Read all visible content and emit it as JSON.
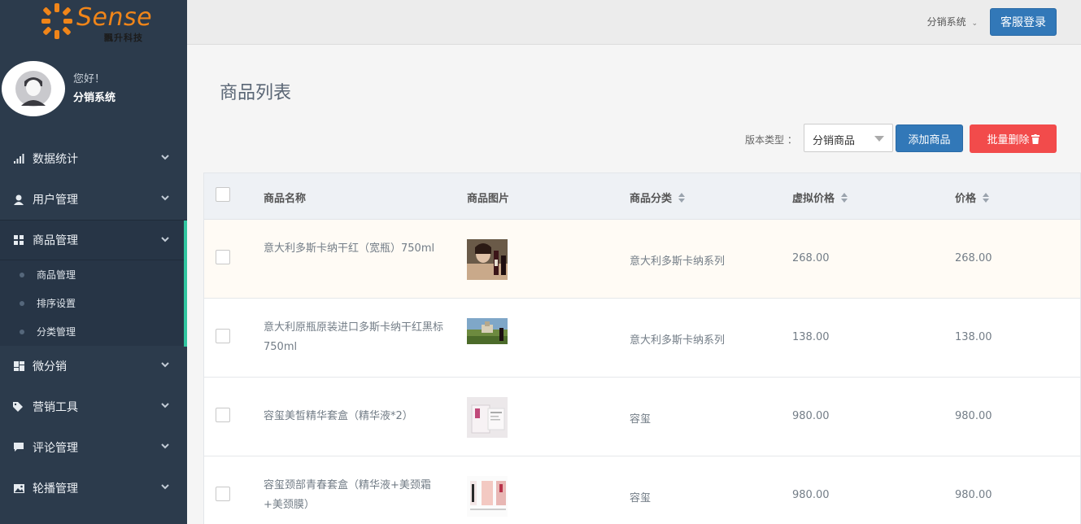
{
  "sidebar": {
    "logo_text": "Sense",
    "logo_sub": "飄升科技",
    "greeting": "您好！",
    "user_name": "分销系统",
    "menu": [
      {
        "label": "数据统计",
        "icon": "bar-chart-icon"
      },
      {
        "label": "用户管理",
        "icon": "user-icon"
      },
      {
        "label": "商品管理",
        "icon": "grid-icon",
        "active": true
      },
      {
        "label": "微分销",
        "icon": "tiles-icon"
      },
      {
        "label": "营销工具",
        "icon": "tag-icon"
      },
      {
        "label": "评论管理",
        "icon": "comment-icon"
      },
      {
        "label": "轮播管理",
        "icon": "picture-icon"
      }
    ],
    "submenu": [
      "商品管理",
      "排序设置",
      "分类管理"
    ]
  },
  "topbar": {
    "system_switch": "分销系统",
    "login_button": "客服登录"
  },
  "page": {
    "title": "商品列表",
    "filter_label": "版本类型 ：",
    "filter_value": "分销商品",
    "add_button": "添加商品",
    "batch_delete_button": "批量删除"
  },
  "table": {
    "columns": [
      "商品名称",
      "商品图片",
      "商品分类",
      "虚拟价格",
      "价格"
    ],
    "rows": [
      {
        "name": "意大利多斯卡纳干红（宽瓶）750ml",
        "category": "意大利多斯卡纳系列",
        "virtual_price": "268.00",
        "price": "268.00"
      },
      {
        "name": "意大利原瓶原装进口多斯卡纳干红黑标750ml",
        "category": "意大利多斯卡纳系列",
        "virtual_price": "138.00",
        "price": "138.00"
      },
      {
        "name": "容玺美皙精华套盒（精华液*2）",
        "category": "容玺",
        "virtual_price": "980.00",
        "price": "980.00"
      },
      {
        "name": "容玺颈部青春套盒（精华液+美颈霜+美颈膜）",
        "category": "容玺",
        "virtual_price": "980.00",
        "price": "980.00"
      }
    ]
  },
  "colors": {
    "sidebar_bg": "#2c3b4c",
    "accent_green": "#31c5a0",
    "primary_blue": "#3278b8",
    "danger_red": "#f24b4b",
    "logo_orange": "#f08519"
  }
}
